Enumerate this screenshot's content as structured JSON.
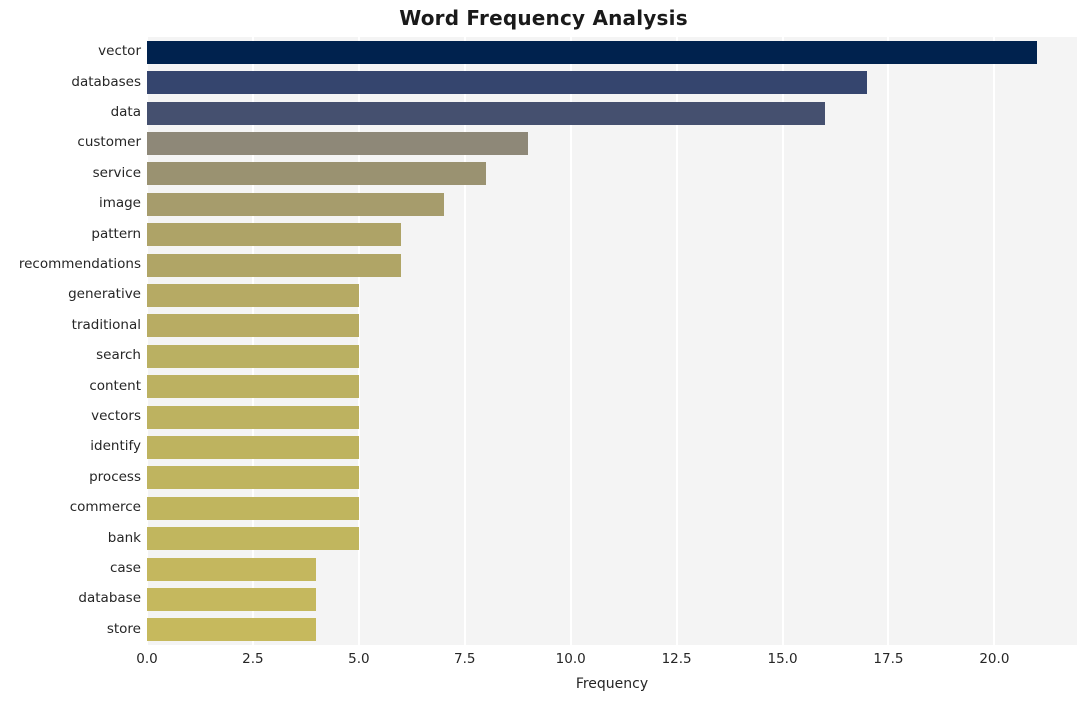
{
  "chart_data": {
    "type": "bar",
    "orientation": "horizontal",
    "title": "Word Frequency Analysis",
    "xlabel": "Frequency",
    "ylabel": "",
    "xlim": [
      0,
      21.95
    ],
    "xticks": [
      0.0,
      2.5,
      5.0,
      7.5,
      10.0,
      12.5,
      15.0,
      17.5,
      20.0
    ],
    "xtick_labels": [
      "0.0",
      "2.5",
      "5.0",
      "7.5",
      "10.0",
      "12.5",
      "15.0",
      "17.5",
      "20.0"
    ],
    "grid": true,
    "grid_axis": "x",
    "grid_color": "#ffffff",
    "plot_background": "#f4f4f4",
    "figure_background": "#ffffff",
    "legend": null,
    "colormap": "cividis",
    "categories": [
      "vector",
      "databases",
      "data",
      "customer",
      "service",
      "image",
      "pattern",
      "recommendations",
      "generative",
      "traditional",
      "search",
      "content",
      "vectors",
      "identify",
      "process",
      "commerce",
      "bank",
      "case",
      "database",
      "store"
    ],
    "values": [
      21,
      17,
      16,
      9,
      8,
      7,
      6,
      6,
      5,
      5,
      5,
      5,
      5,
      5,
      5,
      5,
      5,
      4,
      4,
      4
    ],
    "bar_colors": [
      "#00224e",
      "#35456e",
      "#45506f",
      "#8e8878",
      "#9a9271",
      "#a69c6c",
      "#aea367",
      "#b0a566",
      "#b6aa64",
      "#b8ac63",
      "#bab062",
      "#bcb161",
      "#bdb260",
      "#beb35f",
      "#bfb45f",
      "#c0b55e",
      "#c1b65e",
      "#c4b75e",
      "#c5b85e",
      "#c6b95d"
    ]
  }
}
